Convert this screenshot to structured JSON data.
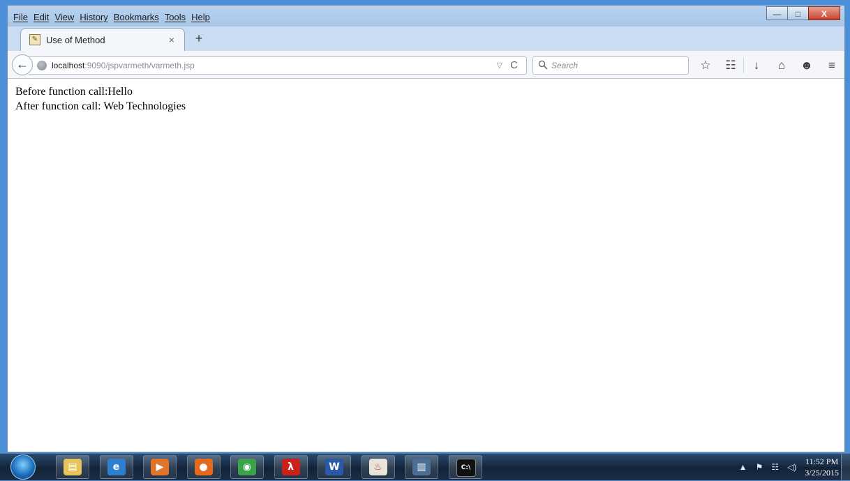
{
  "window": {
    "menu": [
      "File",
      "Edit",
      "View",
      "History",
      "Bookmarks",
      "Tools",
      "Help"
    ],
    "controls": {
      "minimize": "—",
      "maximize": "□",
      "close": "X"
    }
  },
  "tab": {
    "title": "Use of Method",
    "close": "×",
    "new_tab": "+"
  },
  "navbar": {
    "back": "←",
    "url_host": "localhost",
    "url_rest": ":9090/jspvarmeth/varmeth.jsp",
    "dropdown": "▽",
    "reload": "C",
    "search_placeholder": "Search",
    "icons": {
      "bookmark": "☆",
      "reading_list": "☷",
      "download": "↓",
      "home": "⌂",
      "chat": "☻",
      "menu": "≡"
    }
  },
  "content": {
    "line1": "Before function call:Hello",
    "line2": "After function call: Web Technologies"
  },
  "taskbar": {
    "apps": [
      {
        "name": "explorer",
        "glyph": "▤",
        "color": "#e8c25a"
      },
      {
        "name": "ie",
        "glyph": "e",
        "color": "#2f7fd0"
      },
      {
        "name": "media",
        "glyph": "▶",
        "color": "#e0742a"
      },
      {
        "name": "firefox",
        "glyph": "●",
        "color": "#e56a1f"
      },
      {
        "name": "chrome",
        "glyph": "◉",
        "color": "#3aa34a"
      },
      {
        "name": "acrobat",
        "glyph": "λ",
        "color": "#c9221c"
      },
      {
        "name": "word",
        "glyph": "W",
        "color": "#2a5aa6"
      },
      {
        "name": "java",
        "glyph": "♨",
        "color": "#e9e4da"
      },
      {
        "name": "reader",
        "glyph": "▥",
        "color": "#4a6f94"
      },
      {
        "name": "cmd",
        "glyph": "C:\\",
        "color": "#111111"
      }
    ],
    "clock_time": "11:52 PM",
    "clock_date": "3/25/2015",
    "tray": {
      "up": "▲",
      "flag": "⚑",
      "network": "☷",
      "volume": "◁)"
    }
  }
}
